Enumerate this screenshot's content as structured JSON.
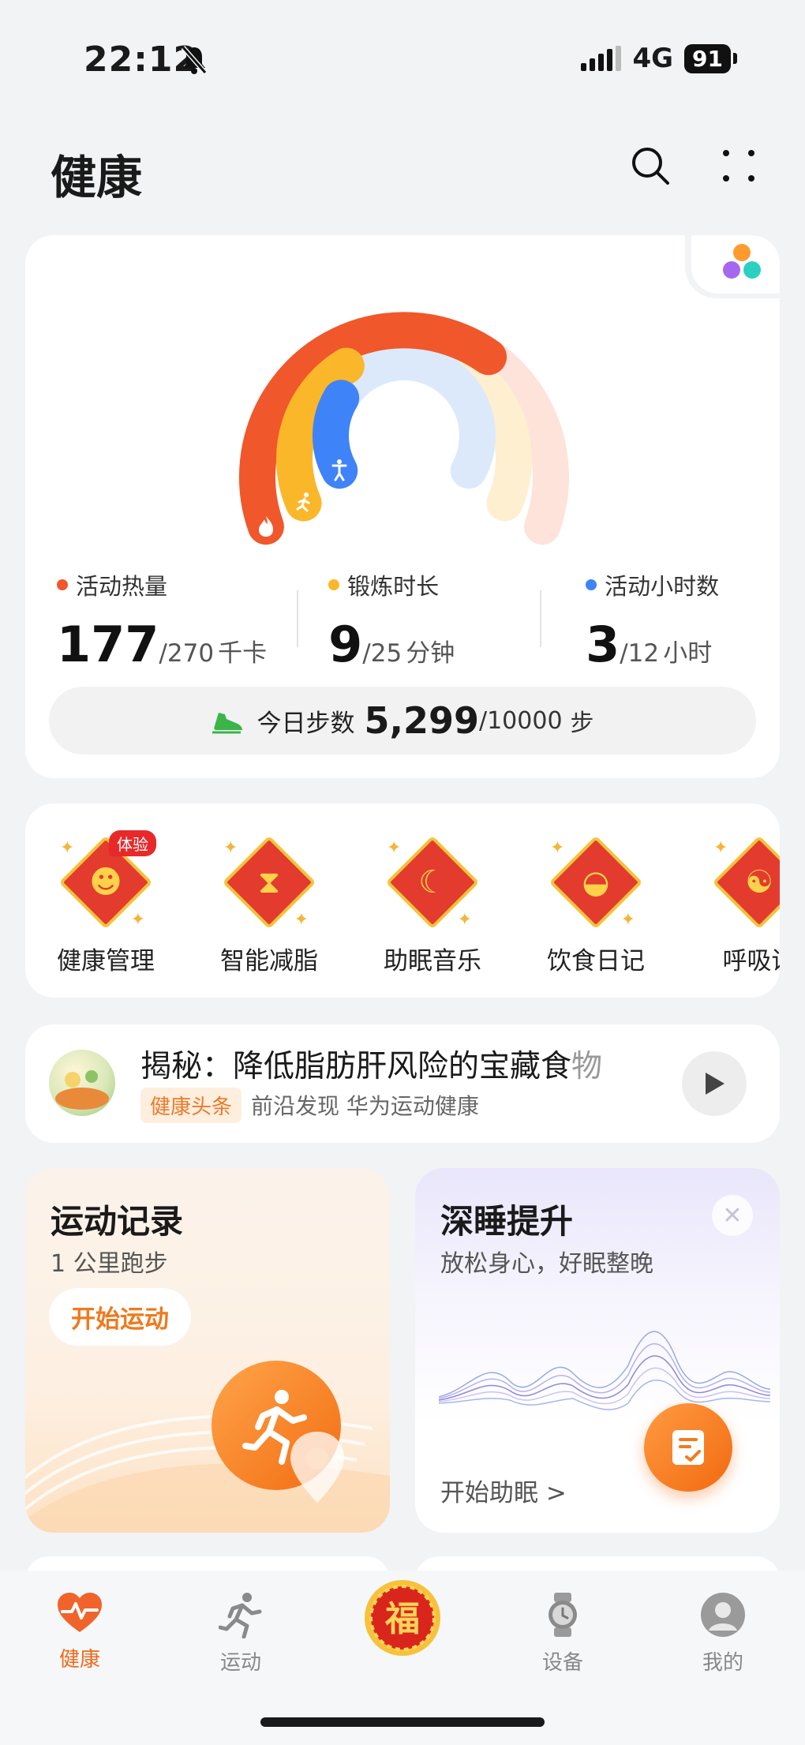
{
  "status_bar": {
    "time": "22:12",
    "network": "4G",
    "battery": "91"
  },
  "header": {
    "title": "健康"
  },
  "rings": {
    "calories": {
      "label": "活动热量",
      "value": "177",
      "goal": "/270",
      "unit": "千卡",
      "color": "#f0572b",
      "progress": 0.66
    },
    "exercise": {
      "label": "锻炼时长",
      "value": "9",
      "goal": "/25",
      "unit": "分钟",
      "color": "#fbb72a",
      "progress": 0.36
    },
    "active_hours": {
      "label": "活动小时数",
      "value": "3",
      "goal": "/12",
      "unit": "小时",
      "color": "#3f83f8",
      "progress": 0.25
    },
    "steps": {
      "label": "今日步数",
      "value": "5,299",
      "goal": "/10000",
      "unit": "步"
    }
  },
  "services": [
    {
      "label": "健康管理",
      "badge": "体验",
      "icon": "doctor-icon"
    },
    {
      "label": "智能减脂",
      "icon": "waist-icon"
    },
    {
      "label": "助眠音乐",
      "icon": "moon-music-icon"
    },
    {
      "label": "饮食日记",
      "icon": "food-bowl-icon"
    },
    {
      "label": "呼吸训",
      "icon": "breath-icon"
    }
  ],
  "news": {
    "title": "揭秘：降低脂肪肝风险的宝藏食",
    "title_faded": "物",
    "tag": "健康头条",
    "meta": "前沿发现 华为运动健康"
  },
  "sport_card": {
    "title": "运动记录",
    "subtitle": "1 公里跑步",
    "button": "开始运动"
  },
  "sleep_card": {
    "title": "深睡提升",
    "subtitle": "放松身心，好眠整晚",
    "link": "开始助眠 >"
  },
  "bottom_nav": [
    {
      "label": "健康",
      "icon": "heart-pulse-icon",
      "active": true
    },
    {
      "label": "运动",
      "icon": "runner-icon"
    },
    {
      "label": "",
      "icon": "fu-festival-icon"
    },
    {
      "label": "设备",
      "icon": "watch-icon"
    },
    {
      "label": "我的",
      "icon": "profile-icon"
    }
  ]
}
